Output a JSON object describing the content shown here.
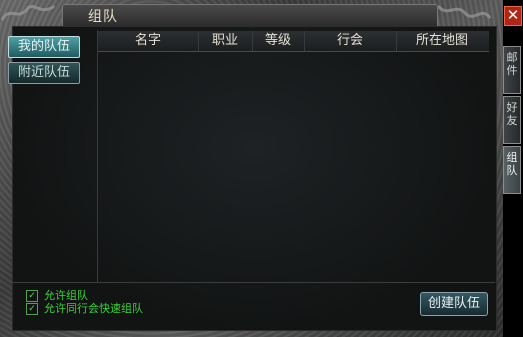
{
  "window": {
    "title": "组队"
  },
  "close": {
    "glyph": "✕"
  },
  "tabs": [
    {
      "label": "我的队伍"
    },
    {
      "label": "附近队伍"
    }
  ],
  "columns": [
    "名字",
    "职业",
    "等级",
    "行会",
    "所在地图"
  ],
  "options": [
    {
      "label": "允许组队",
      "checked": true
    },
    {
      "label": "允许同行会快速组队",
      "checked": true
    }
  ],
  "actions": {
    "create": "创建队伍"
  },
  "side_tabs": [
    {
      "label_top": "邮",
      "label_bottom": "件"
    },
    {
      "label_top": "好",
      "label_bottom": "友"
    },
    {
      "label_top": "组",
      "label_bottom": "队"
    }
  ],
  "colors": {
    "accent_green": "#38d238",
    "close_red": "#b02616",
    "tab_active": "#4fa0a5"
  }
}
